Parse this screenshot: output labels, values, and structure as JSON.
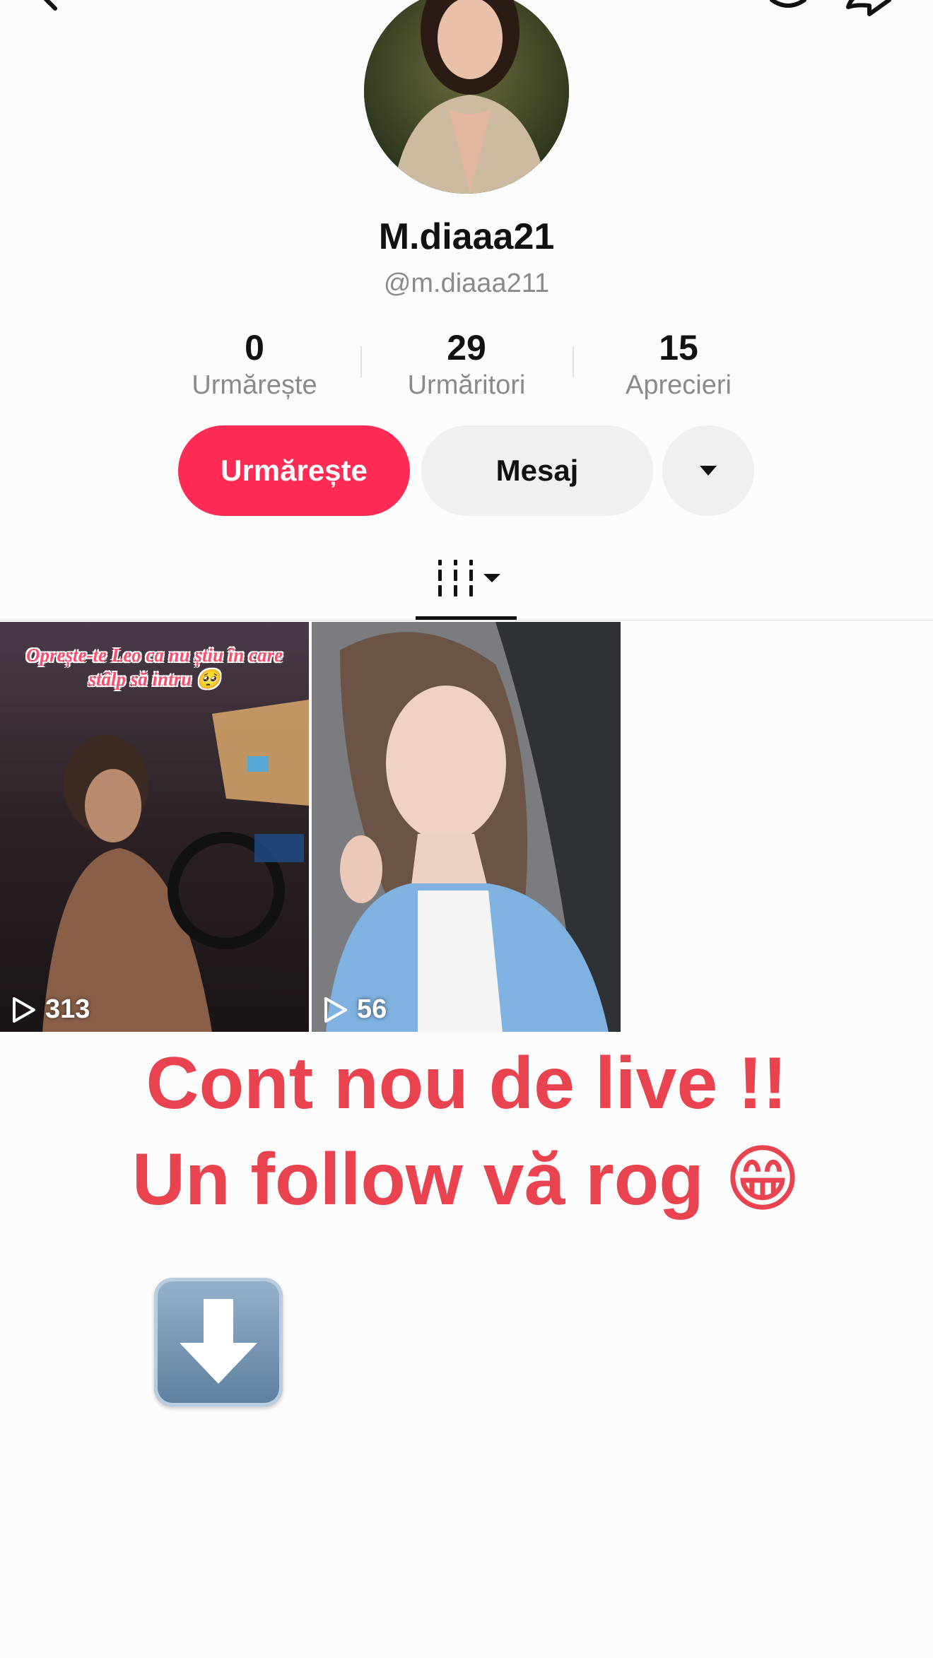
{
  "icons": {
    "back": "back-arrow-icon",
    "notifications": "bell-icon",
    "share": "share-icon",
    "more": "caret-down-icon",
    "videos_tab": "video-grid-icon",
    "play": "play-icon",
    "emoji_grin": "grinning-face-emoji",
    "emoji_arrow": "down-arrow-emoji"
  },
  "profile": {
    "display_name": "M.diaaa21",
    "handle": "@m.diaaa211"
  },
  "stats": [
    {
      "value": "0",
      "label": "Urmărește"
    },
    {
      "value": "29",
      "label": "Urmăritori"
    },
    {
      "value": "15",
      "label": "Aprecieri"
    }
  ],
  "actions": {
    "follow_label": "Urmărește",
    "message_label": "Mesaj"
  },
  "videos": [
    {
      "caption": "Oprește-te Leo ca nu știu în care stâlp să intru 🥺",
      "views": "313"
    },
    {
      "caption": "",
      "views": "56"
    }
  ],
  "promo": {
    "line1": "Cont nou de live !!",
    "line2": "Un follow vă rog",
    "line2_emoji": "😁"
  },
  "colors": {
    "accent": "#fe2c55",
    "promo_text": "#e8434f",
    "secondary_button": "#f0f0f0",
    "muted_text": "#8a8a8a"
  }
}
